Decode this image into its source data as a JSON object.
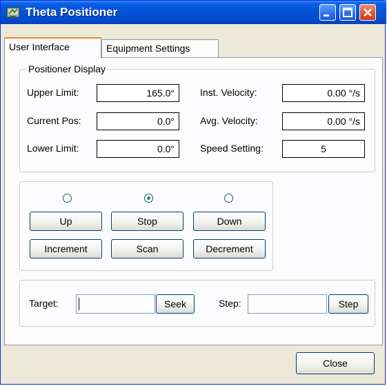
{
  "window": {
    "title": "Theta Positioner",
    "icon": "app-icon",
    "controls": [
      "minimize-icon",
      "maximize-icon",
      "close-icon"
    ]
  },
  "tabs": [
    {
      "label": "User Interface",
      "active": true
    },
    {
      "label": "Equipment Settings",
      "active": false
    }
  ],
  "positioner_display": {
    "group_label": "Positioner Display",
    "upper_limit": {
      "label": "Upper Limit:",
      "value": "165.0°"
    },
    "current_pos": {
      "label": "Current Pos:",
      "value": "0.0°"
    },
    "lower_limit": {
      "label": "Lower Limit:",
      "value": "0.0°"
    },
    "inst_velocity": {
      "label": "Inst. Velocity:",
      "value": "0.00 °/s"
    },
    "avg_velocity": {
      "label": "Avg. Velocity:",
      "value": "0.00 °/s"
    },
    "speed_setting": {
      "label": "Speed Setting:",
      "value": "5"
    }
  },
  "motion": {
    "radios": [
      {
        "name": "radio-up",
        "selected": false
      },
      {
        "name": "radio-stop",
        "selected": true
      },
      {
        "name": "radio-down",
        "selected": false
      }
    ],
    "buttons": {
      "up": "Up",
      "stop": "Stop",
      "down": "Down",
      "increment": "Increment",
      "scan": "Scan",
      "decrement": "Decrement"
    }
  },
  "target_panel": {
    "target_label": "Target:",
    "target_value": "",
    "seek_button": "Seek",
    "step_label": "Step:",
    "step_value": "",
    "step_button": "Step"
  },
  "footer": {
    "close_button": "Close"
  }
}
